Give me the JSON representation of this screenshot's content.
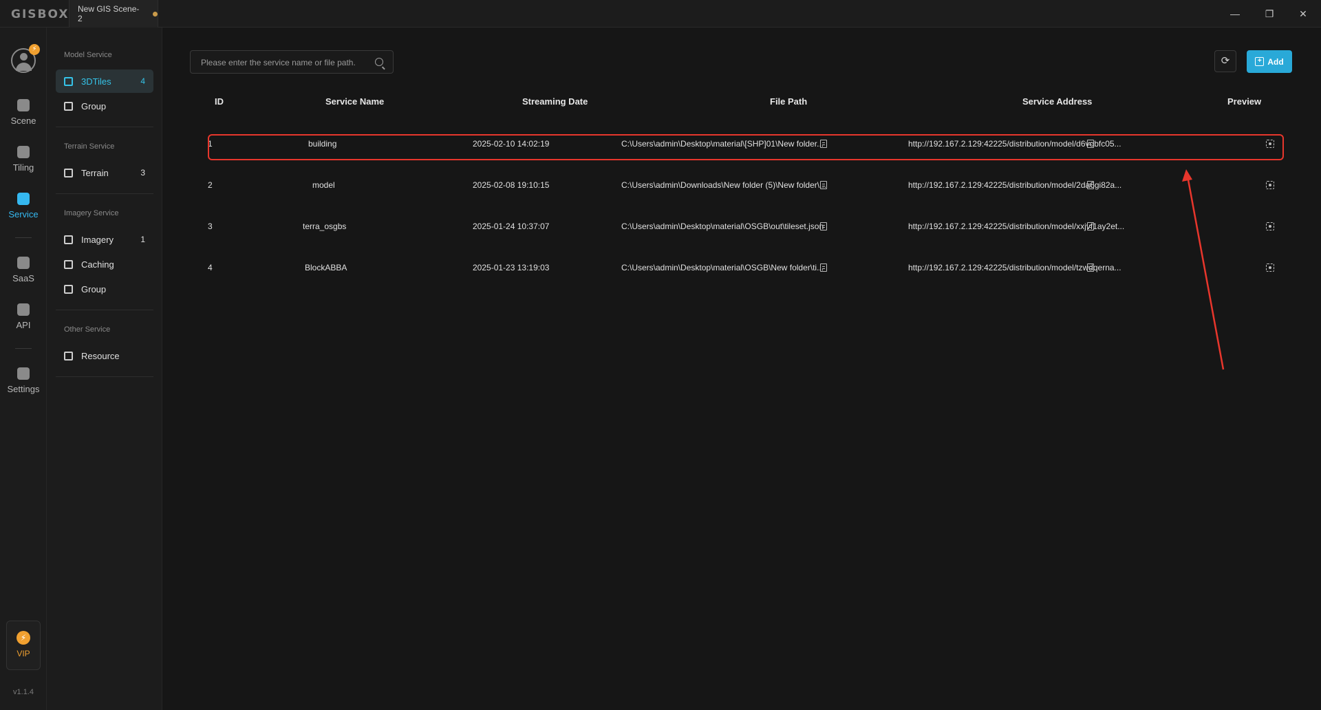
{
  "titlebar": {
    "logo": "GISBOX",
    "tab_label": "New GIS Scene-2",
    "minimize": "—",
    "restore": "❐",
    "close": "✕"
  },
  "rail": {
    "items": [
      {
        "label": "Scene",
        "icon": "home-icon"
      },
      {
        "label": "Tiling",
        "icon": "tiling-icon"
      },
      {
        "label": "Service",
        "icon": "service-icon"
      },
      {
        "label": "SaaS",
        "icon": "lock-icon"
      },
      {
        "label": "API",
        "icon": "link-icon"
      },
      {
        "label": "Settings",
        "icon": "gear-icon"
      }
    ],
    "vip_label": "VIP",
    "version": "v1.1.4"
  },
  "subnav": {
    "model_title": "Model Service",
    "model_items": [
      {
        "label": "3DTiles",
        "count": "4"
      },
      {
        "label": "Group",
        "count": ""
      }
    ],
    "terrain_title": "Terrain Service",
    "terrain_items": [
      {
        "label": "Terrain",
        "count": "3"
      }
    ],
    "imagery_title": "Imagery Service",
    "imagery_items": [
      {
        "label": "Imagery",
        "count": "1"
      },
      {
        "label": "Caching",
        "count": ""
      },
      {
        "label": "Group",
        "count": ""
      }
    ],
    "other_title": "Other Service",
    "other_items": [
      {
        "label": "Resource",
        "count": ""
      }
    ]
  },
  "toolbar": {
    "search_placeholder": "Please enter the service name or file path.",
    "refresh": "⟳",
    "add_label": "Add"
  },
  "table": {
    "headers": [
      "ID",
      "Service Name",
      "Streaming Date",
      "File Path",
      "Service Address",
      "Preview"
    ],
    "rows": [
      {
        "id": "1",
        "name": "building",
        "date": "2025-02-10 14:02:19",
        "path": "C:\\Users\\admin\\Desktop\\material\\[SHP]01\\New folder...",
        "address": "http://192.167.2.129:42225/distribution/model/d6vobfc05..."
      },
      {
        "id": "2",
        "name": "model",
        "date": "2025-02-08 19:10:15",
        "path": "C:\\Users\\admin\\Downloads\\New folder (5)\\New folder\\...",
        "address": "http://192.167.2.129:42225/distribution/model/2da6gi82a..."
      },
      {
        "id": "3",
        "name": "terra_osgbs",
        "date": "2025-01-24 10:37:07",
        "path": "C:\\Users\\admin\\Desktop\\material\\OSGB\\out\\tileset.json",
        "address": "http://192.167.2.129:42225/distribution/model/xxjvf1ay2et..."
      },
      {
        "id": "4",
        "name": "BlockABBA",
        "date": "2025-01-23 13:19:03",
        "path": "C:\\Users\\admin\\Desktop\\material\\OSGB\\New folder\\ti...",
        "address": "http://192.167.2.129:42225/distribution/model/tzwdqerna..."
      }
    ]
  },
  "colors": {
    "accent": "#35c3e8",
    "highlight": "#e8362c",
    "vip": "#f0a030"
  }
}
